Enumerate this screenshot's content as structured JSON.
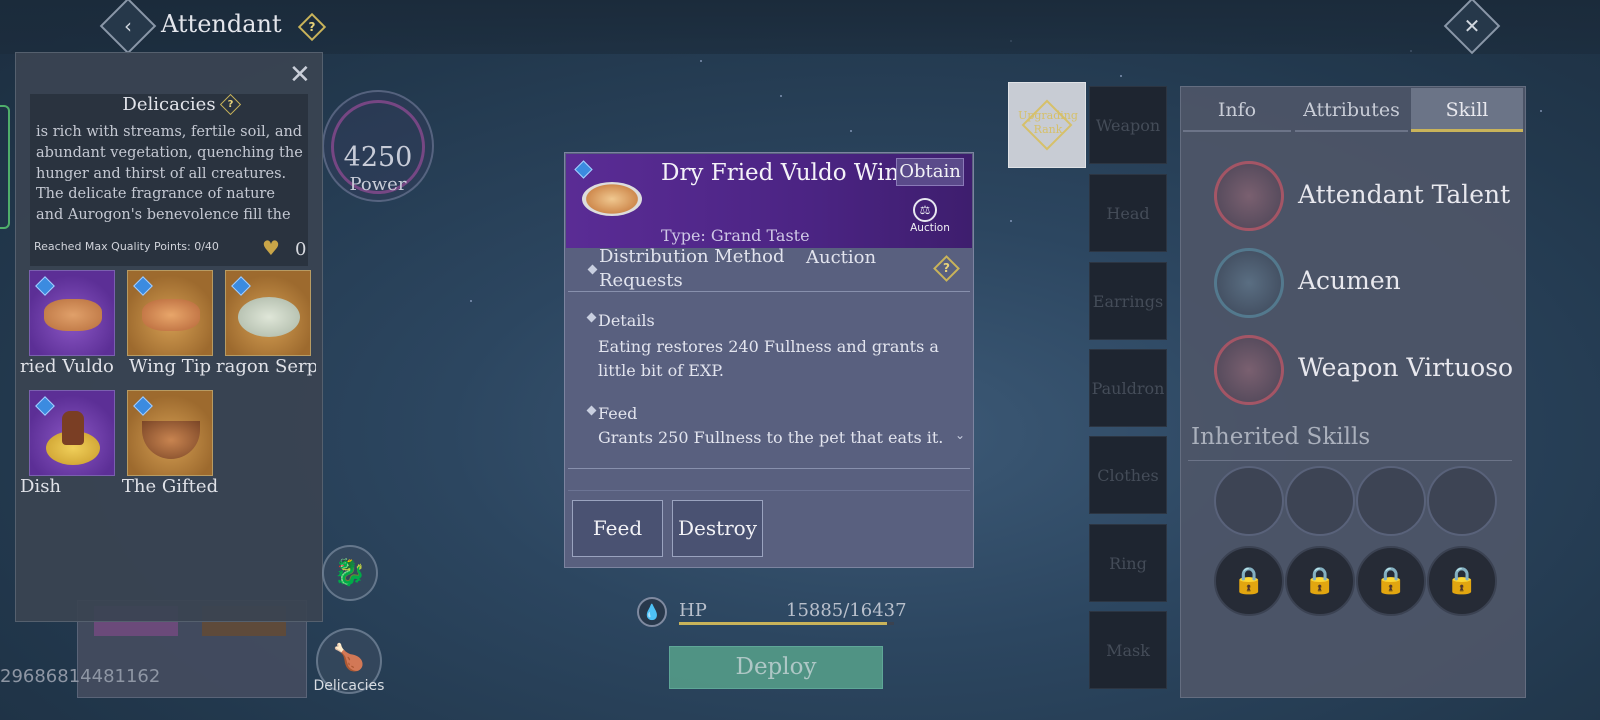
{
  "header": {
    "title": "Attendant",
    "back_icon": "chevron-left-icon",
    "help_icon": "question-icon",
    "close_icon": "close-icon"
  },
  "left_panel": {
    "section_title": "Delicacies",
    "description": "is rich with streams, fertile soil, and abundant vegetation, quenching the hunger and thirst of all creatures. The delicate fragrance of nature and Aurogon's benevolence fill the",
    "quality_label": "Reached Max Quality Points: 0/40",
    "heart_count": "0",
    "items": [
      {
        "name": "ried Vuldo",
        "tile": "purple",
        "food": "wings"
      },
      {
        "name": "Wing Tip",
        "tile": "orange",
        "food": "wings"
      },
      {
        "name": "ragon Serpe",
        "tile": "orange",
        "food": "soup"
      },
      {
        "name": "Dish",
        "tile": "purple",
        "food": "pot"
      },
      {
        "name": "The Gifted",
        "tile": "orange",
        "food": "bowl"
      }
    ]
  },
  "power": {
    "value": "4250",
    "label": "Power"
  },
  "player_id": "29686814481162",
  "delicacies_button": "Delicacies",
  "popup": {
    "title": "Dry Fried Vuldo Wing",
    "obtain": "Obtain",
    "type": "Type: Grand Taste",
    "auction_label": "Auction",
    "distribution_label": "Distribution Method",
    "distribution_value": "Auction Requests",
    "details_title": "Details",
    "details_text": "Eating restores 240 Fullness and grants a little bit of EXP.",
    "feed_title": "Feed",
    "feed_text": "Grants 250 Fullness to the pet that eats it.",
    "feed_button": "Feed",
    "destroy_button": "Destroy"
  },
  "hp": {
    "label": "HP",
    "value": "15885/16437",
    "fraction": 0.966
  },
  "deploy_button": "Deploy",
  "equipment": {
    "upgrade_label": "Upgrading Rank",
    "slots": [
      "Weapon",
      "Head",
      "Earrings",
      "Pauldron",
      "Clothes",
      "Ring",
      "Mask"
    ]
  },
  "right_panel": {
    "tabs": [
      "Info",
      "Attributes",
      "Skill"
    ],
    "active_tab": "Skill",
    "skills": [
      {
        "name": "Attendant Talent",
        "color": "#c45a6a"
      },
      {
        "name": "Acumen",
        "color": "#5a8aa0"
      },
      {
        "name": "Weapon Virtuoso",
        "color": "#c45a6a"
      }
    ],
    "inherited_title": "Inherited Skills"
  },
  "colors": {
    "popup_header": "#5a2c95",
    "accent_gold": "#c9b35a",
    "deploy": "#5aa78e"
  }
}
